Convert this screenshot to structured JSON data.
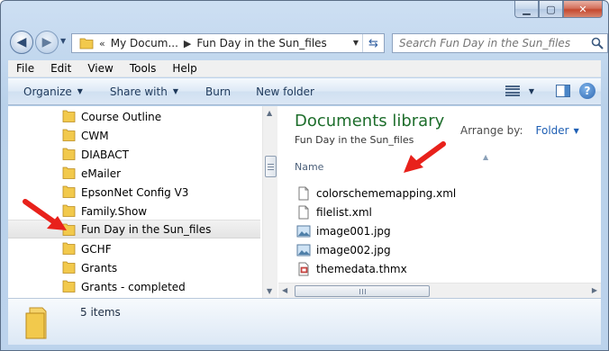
{
  "window": {
    "caption": {
      "minimize": "▁",
      "maximize": "▢",
      "close": "✕"
    }
  },
  "address_bar": {
    "overflow": "«",
    "crumbs": [
      "My Docum...",
      "Fun Day in the Sun_files"
    ]
  },
  "search": {
    "placeholder": "Search Fun Day in the Sun_files"
  },
  "menu": [
    "File",
    "Edit",
    "View",
    "Tools",
    "Help"
  ],
  "toolbar": {
    "organize": "Organize",
    "share_with": "Share with",
    "burn": "Burn",
    "new_folder": "New folder"
  },
  "nav_tree": [
    "Course Outline",
    "CWM",
    "DIABACT",
    "eMailer",
    "EpsonNet Config V3",
    "Family.Show",
    "Fun Day in the Sun_files",
    "GCHF",
    "Grants",
    "Grants - completed"
  ],
  "library": {
    "title": "Documents library",
    "subtitle": "Fun Day in the Sun_files",
    "arrange_label": "Arrange by:",
    "arrange_value": "Folder",
    "column_name": "Name"
  },
  "files": [
    {
      "name": "colorschememapping.xml",
      "icon": "xml-file-icon"
    },
    {
      "name": "filelist.xml",
      "icon": "xml-file-icon"
    },
    {
      "name": "image001.jpg",
      "icon": "jpg-image-icon"
    },
    {
      "name": "image002.jpg",
      "icon": "jpg-image-icon"
    },
    {
      "name": "themedata.thmx",
      "icon": "thmx-file-icon"
    }
  ],
  "details": {
    "item_count": "5 items"
  },
  "colors": {
    "library_title": "#1e6e2c",
    "annotation_arrow": "#e8211b",
    "folder_yellow": "#f2c94c"
  }
}
